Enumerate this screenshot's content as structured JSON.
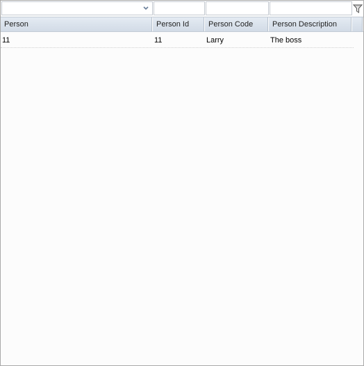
{
  "filters": {
    "person": "",
    "person_id": "",
    "person_code": "",
    "person_description": ""
  },
  "columns": [
    "Person",
    "Person Id",
    "Person Code",
    "Person Description"
  ],
  "rows": [
    {
      "person": "11",
      "person_id": "11",
      "person_code": "Larry",
      "person_description": "The boss"
    }
  ],
  "icons": {
    "dropdown": "chevron-down-icon",
    "filter": "funnel-icon"
  }
}
